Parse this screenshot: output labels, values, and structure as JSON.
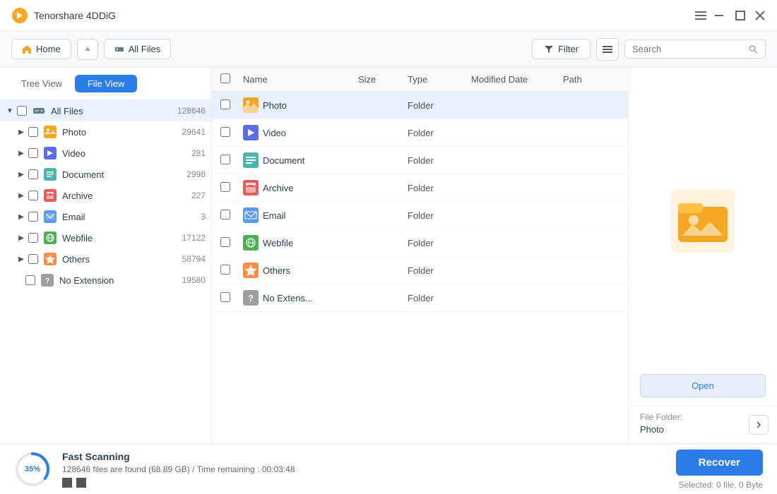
{
  "app": {
    "title": "Tenorshare 4DDiG",
    "logo_color": "#f5a623"
  },
  "titlebar": {
    "controls": [
      "menu",
      "minimize",
      "maximize",
      "close"
    ]
  },
  "toolbar": {
    "home_label": "Home",
    "path_label": "All Files",
    "filter_label": "Filter",
    "search_placeholder": "Search"
  },
  "sidebar": {
    "tree_view_label": "Tree View",
    "file_view_label": "File View",
    "items": [
      {
        "label": "All Files",
        "count": "128646",
        "indent": 0,
        "expanded": true,
        "icon": "hdd"
      },
      {
        "label": "Photo",
        "count": "29641",
        "indent": 1,
        "icon": "photo"
      },
      {
        "label": "Video",
        "count": "281",
        "indent": 1,
        "icon": "video"
      },
      {
        "label": "Document",
        "count": "2998",
        "indent": 1,
        "icon": "document"
      },
      {
        "label": "Archive",
        "count": "227",
        "indent": 1,
        "icon": "archive"
      },
      {
        "label": "Email",
        "count": "3",
        "indent": 1,
        "icon": "email"
      },
      {
        "label": "Webfile",
        "count": "17122",
        "indent": 1,
        "icon": "webfile"
      },
      {
        "label": "Others",
        "count": "58794",
        "indent": 1,
        "icon": "others"
      },
      {
        "label": "No Extension",
        "count": "19580",
        "indent": 1,
        "icon": "noext"
      }
    ]
  },
  "filelist": {
    "columns": [
      "Name",
      "Size",
      "Type",
      "Modified Date",
      "Path"
    ],
    "rows": [
      {
        "name": "Photo",
        "size": "",
        "type": "Folder",
        "date": "",
        "path": "",
        "icon": "photo",
        "selected": true
      },
      {
        "name": "Video",
        "size": "",
        "type": "Folder",
        "date": "",
        "path": "",
        "icon": "video",
        "selected": false
      },
      {
        "name": "Document",
        "size": "",
        "type": "Folder",
        "date": "",
        "path": "",
        "icon": "document",
        "selected": false
      },
      {
        "name": "Archive",
        "size": "",
        "type": "Folder",
        "date": "",
        "path": "",
        "icon": "archive",
        "selected": false
      },
      {
        "name": "Email",
        "size": "",
        "type": "Folder",
        "date": "",
        "path": "",
        "icon": "email",
        "selected": false
      },
      {
        "name": "Webfile",
        "size": "",
        "type": "Folder",
        "date": "",
        "path": "",
        "icon": "webfile",
        "selected": false
      },
      {
        "name": "Others",
        "size": "",
        "type": "Folder",
        "date": "",
        "path": "",
        "icon": "others",
        "selected": false
      },
      {
        "name": "No Extens...",
        "size": "",
        "type": "Folder",
        "date": "",
        "path": "",
        "icon": "noext",
        "selected": false
      }
    ]
  },
  "preview": {
    "open_label": "Open",
    "file_folder_label": "File Folder:",
    "file_folder_value": "Photo"
  },
  "bottombar": {
    "progress_pct": "35%",
    "scan_title": "Fast Scanning",
    "scan_details": "128646 files are found (68.89 GB)  /  Time remaining : 00:03:48",
    "recover_label": "Recover",
    "selected_info": "Selected: 0 file, 0 Byte"
  }
}
